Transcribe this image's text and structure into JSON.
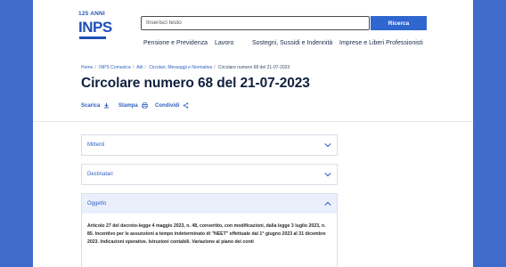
{
  "logo": {
    "anniversary": "125 ANNI",
    "brand": "INPS"
  },
  "search": {
    "placeholder": "Inserisci testo",
    "button_label": "Ricerca"
  },
  "nav": [
    {
      "label": "Pensione e Previdenza"
    },
    {
      "label": "Lavoro"
    },
    {
      "label": "Sostegni, Sussidi e Indennità"
    },
    {
      "label": "Imprese e Liberi Professionisti"
    }
  ],
  "breadcrumb": [
    "Home",
    "INPS Comunica",
    "Atti",
    "Circolari, Messaggi e Normativa",
    "Circolare numero 68 del 21-07-2023"
  ],
  "page_title": "Circolare numero 68 del 21-07-2023",
  "actions": {
    "download": "Scarica",
    "print": "Stampa",
    "share": "Condividi"
  },
  "accordion": [
    {
      "label": "Mittenti",
      "expanded": false
    },
    {
      "label": "Destinatari",
      "expanded": false
    },
    {
      "label": "Oggetto",
      "expanded": true,
      "body": "Articolo 27 del decreto-legge 4 maggio 2023, n. 48, convertito, con modificazioni, dalla legge 3 luglio 2023, n. 85. Incentivo per le assunzioni a tempo indeterminato di \"NEET\" effettuate dal 1° giugno 2023 al 31 dicembre 2023. Indicazioni operative. Istruzioni contabili. Variazione al piano dei conti"
    }
  ],
  "colors": {
    "background": "#3f6ccc",
    "accent": "#2f66cf",
    "title": "#10203f"
  }
}
